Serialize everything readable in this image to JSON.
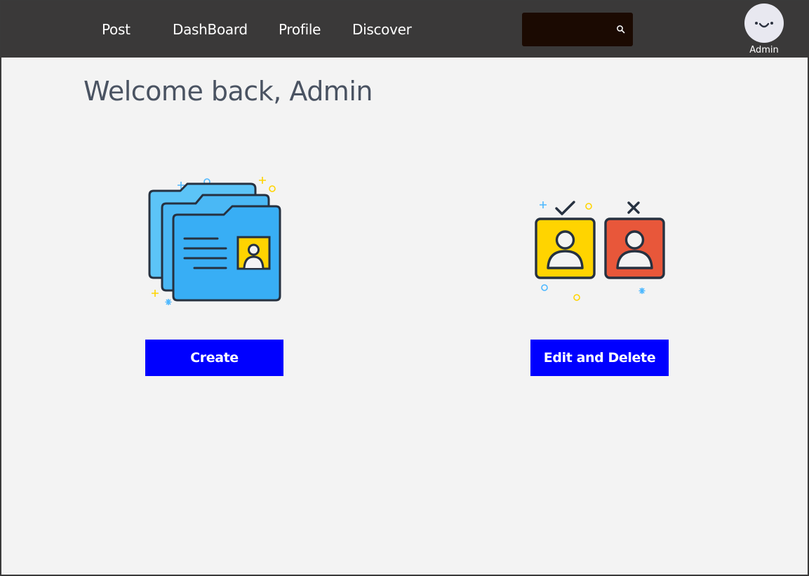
{
  "nav": {
    "links": [
      {
        "label": "Post"
      },
      {
        "label": "DashBoard"
      },
      {
        "label": "Profile"
      },
      {
        "label": "Discover"
      }
    ],
    "search": {
      "value": "",
      "placeholder": ""
    },
    "user": {
      "label": "Admin"
    }
  },
  "main": {
    "title": "Welcome back, Admin",
    "cards": [
      {
        "button_label": "Create",
        "illustration": "folder-contact-icon"
      },
      {
        "button_label": "Edit and Delete",
        "illustration": "approve-reject-users-icon"
      }
    ]
  },
  "colors": {
    "navbar": "#3a3939",
    "background": "#f3f3f3",
    "button": "#0000ff",
    "title": "#4a5362",
    "search_box": "#1b0a02"
  }
}
